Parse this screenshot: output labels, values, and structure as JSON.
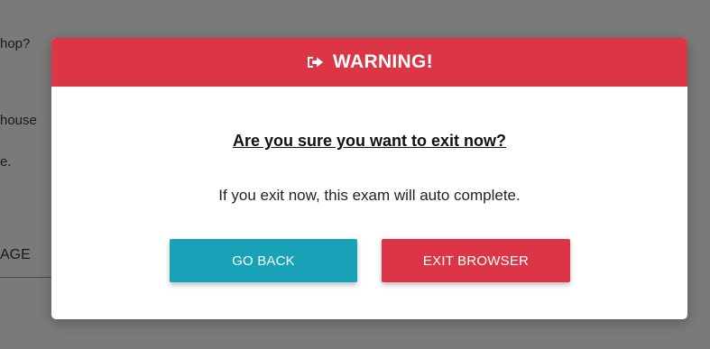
{
  "background": {
    "question_fragment_1": "hop?",
    "question_fragment_2": "house",
    "question_fragment_3": "e.",
    "input_fragment": "AGE"
  },
  "modal": {
    "header_icon": "sign-out-icon",
    "title": "WARNING!",
    "question": "Are you sure you want to exit now?",
    "message": "If you exit now, this exam will auto complete.",
    "go_back_label": "GO BACK",
    "exit_label": "EXIT BROWSER"
  },
  "colors": {
    "danger": "#dc3545",
    "info": "#17a2b8",
    "overlay": "#7a7a7a"
  }
}
